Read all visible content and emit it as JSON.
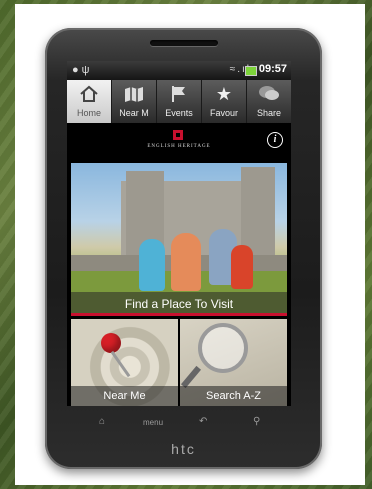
{
  "status_bar": {
    "time": "09:57"
  },
  "tabs": [
    {
      "label": "Home",
      "icon": "home-icon",
      "active": true
    },
    {
      "label": "Near M",
      "icon": "map-icon"
    },
    {
      "label": "Events",
      "icon": "flag-icon"
    },
    {
      "label": "Favour",
      "icon": "star-icon"
    },
    {
      "label": "Share",
      "icon": "speech-bubble-icon"
    }
  ],
  "brand": {
    "text": "ENGLISH HERITAGE",
    "logo_color": "#c8102e"
  },
  "hero": {
    "label": "Find a Place To Visit"
  },
  "tiles": {
    "near_me": "Near Me",
    "search": "Search A-Z"
  },
  "softkeys": {
    "menu": "menu"
  },
  "phone_brand": "htc"
}
